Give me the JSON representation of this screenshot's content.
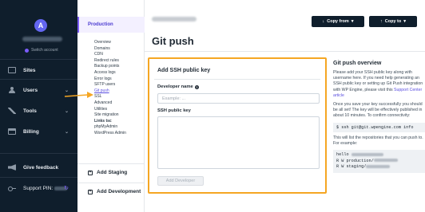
{
  "nav": {
    "avatar_letter": "A",
    "switch_account": "Switch account",
    "items": [
      {
        "label": "Sites",
        "icon": "sites-icon"
      },
      {
        "label": "Users",
        "icon": "users-icon"
      },
      {
        "label": "Tools",
        "icon": "tools-icon"
      },
      {
        "label": "Billing",
        "icon": "billing-icon"
      }
    ],
    "give_feedback": "Give feedback",
    "support_pin": "Support PIN:"
  },
  "subnav": {
    "environment": "Production",
    "items": [
      "Overview",
      "Domains",
      "CDN",
      "Redirect rules",
      "Backup points",
      "Access logs",
      "Error logs",
      "SFTP users",
      "Git push",
      "SSL",
      "Advanced",
      "Utilities",
      "Site migration",
      "Links tsc",
      "phpMyAdmin",
      "WordPress Admin"
    ],
    "active_index": 8,
    "bold_index": 13,
    "add_staging": "Add Staging",
    "add_development": "Add Development"
  },
  "header": {
    "copy_from": "Copy from",
    "copy_to": "Copy to",
    "page_title": "Git push"
  },
  "form": {
    "title": "Add SSH public key",
    "developer_label": "Developer name",
    "developer_placeholder": "Example: ...",
    "ssh_label": "SSH public key",
    "ssh_placeholder": "",
    "submit": "Add Developer"
  },
  "overview": {
    "title": "Git push overview",
    "p1": "Please add your SSH public key along with username here. If you need help generating an SSH public key or setting up Git Push integration with WP Engine, please visit this",
    "p1_link": "Support Center article",
    "p2": "Once you save your key successfully you should be all set! The key will be effectively published in about 10 minutes. To confirm connectivity:",
    "cmd": "$ ssh git@git.wpengine.com info",
    "p3": "This will list the repositories that you can push to. For example:",
    "code_lines": [
      "hello",
      " R W production/",
      " R W staging/"
    ]
  },
  "colors": {
    "nav_bg": "#0f1e2c",
    "accent": "#7c5cfc",
    "highlight_border": "#f5a623"
  }
}
